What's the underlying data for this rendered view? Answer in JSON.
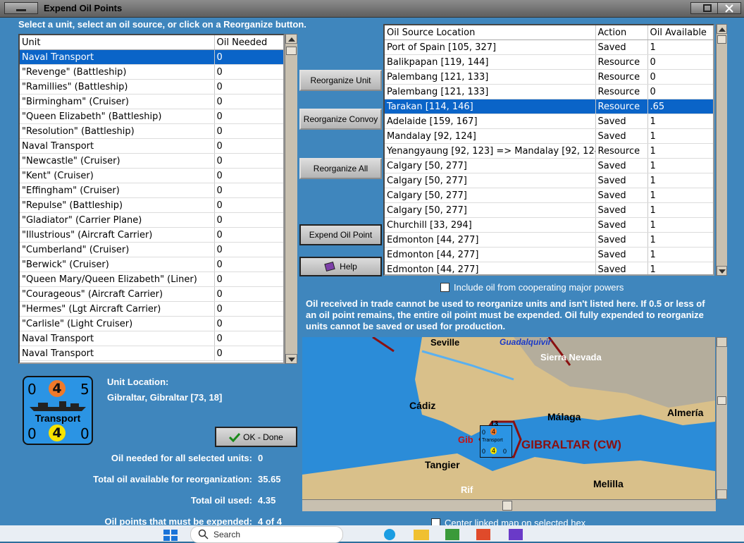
{
  "window": {
    "title": "Expend Oil Points"
  },
  "instruction": "Select a unit, select an oil source, or click on a Reorganize button.",
  "units_table": {
    "headers": [
      "Unit",
      "Oil Needed"
    ],
    "rows": [
      [
        "Naval Transport",
        "0"
      ],
      [
        "\"Revenge\" (Battleship)",
        "0"
      ],
      [
        "\"Ramillies\" (Battleship)",
        "0"
      ],
      [
        "\"Birmingham\" (Cruiser)",
        "0"
      ],
      [
        "\"Queen Elizabeth\" (Battleship)",
        "0"
      ],
      [
        "\"Resolution\" (Battleship)",
        "0"
      ],
      [
        "Naval Transport",
        "0"
      ],
      [
        "\"Newcastle\" (Cruiser)",
        "0"
      ],
      [
        "\"Kent\" (Cruiser)",
        "0"
      ],
      [
        "\"Effingham\" (Cruiser)",
        "0"
      ],
      [
        "\"Repulse\" (Battleship)",
        "0"
      ],
      [
        "\"Gladiator\" (Carrier Plane)",
        "0"
      ],
      [
        "\"Illustrious\" (Aircraft Carrier)",
        "0"
      ],
      [
        "\"Cumberland\" (Cruiser)",
        "0"
      ],
      [
        "\"Berwick\" (Cruiser)",
        "0"
      ],
      [
        "\"Queen Mary/Queen Elizabeth\" (Liner)",
        "0"
      ],
      [
        "\"Courageous\" (Aircraft Carrier)",
        "0"
      ],
      [
        "\"Hermes\" (Lgt Aircraft Carrier)",
        "0"
      ],
      [
        "\"Carlisle\" (Light Cruiser)",
        "0"
      ],
      [
        "Naval Transport",
        "0"
      ],
      [
        "Naval Transport",
        "0"
      ]
    ],
    "selected_index": 0
  },
  "buttons": {
    "reorganize_unit": "Reorganize Unit",
    "reorganize_convoy": "Reorganize Convoy",
    "reorganize_all": "Reorganize All",
    "expend_oil_point": "Expend Oil Point",
    "help": "Help",
    "ok_done": "OK - Done"
  },
  "oil_table": {
    "headers": [
      "Oil Source Location",
      "Action",
      "Oil Available"
    ],
    "rows": [
      [
        "Port of Spain [105, 327]",
        "Saved",
        "1"
      ],
      [
        "Balikpapan [119, 144]",
        "Resource",
        "0"
      ],
      [
        "Palembang [121, 133]",
        "Resource",
        "0"
      ],
      [
        "Palembang [121, 133]",
        "Resource",
        "0"
      ],
      [
        "Tarakan [114, 146]",
        "Resource",
        ".65"
      ],
      [
        "Adelaide [159, 167]",
        "Saved",
        "1"
      ],
      [
        "Mandalay [92, 124]",
        "Saved",
        "1"
      ],
      [
        "Yenangyaung [92, 123] => Mandalay [92, 124]",
        "Resource",
        "1"
      ],
      [
        "Calgary [50, 277]",
        "Saved",
        "1"
      ],
      [
        "Calgary [50, 277]",
        "Saved",
        "1"
      ],
      [
        "Calgary [50, 277]",
        "Saved",
        "1"
      ],
      [
        "Calgary [50, 277]",
        "Saved",
        "1"
      ],
      [
        "Churchill [33, 294]",
        "Saved",
        "1"
      ],
      [
        "Edmonton [44, 277]",
        "Saved",
        "1"
      ],
      [
        "Edmonton [44, 277]",
        "Saved",
        "1"
      ],
      [
        "Edmonton [44, 277]",
        "Saved",
        "1"
      ]
    ],
    "selected_index": 4
  },
  "include_coop_label": "Include oil from cooperating major powers",
  "note": "Oil received in trade cannot be used to reorganize units and isn't listed here.  If 0.5 or less of an oil point remains, the entire oil point must be expended.   Oil fully expended to reorganize units cannot be saved or used for production.",
  "counter": {
    "tl": "0",
    "tc": "4",
    "tr": "5",
    "name": "Transport",
    "bl": "0",
    "bc": "4",
    "br": "0"
  },
  "unit_location": {
    "label": "Unit Location:",
    "value": "Gibraltar, Gibraltar [73, 18]"
  },
  "stats": [
    {
      "label": "Oil needed for all selected units:",
      "value": "0"
    },
    {
      "label": "Total oil available for reorganization:",
      "value": "35.65"
    },
    {
      "label": "Total oil used:",
      "value": "4.35"
    },
    {
      "label": "Oil points that must be expended:",
      "value": "4 of 4"
    }
  ],
  "center_map_label": "Center linked map on selected hex",
  "map": {
    "labels": [
      "Seville",
      "Guadalquivir",
      "Sierra Nevada",
      "Cádiz",
      "Málaga",
      "Almería",
      "GIBRALTAR (CW)",
      "Gib",
      "Tangier",
      "Melilla",
      "Rif"
    ],
    "stack": {
      "top": "13",
      "tl": "0",
      "tc": "4",
      "name": "Transport",
      "bl": "0",
      "bc": "4",
      "br": "0"
    }
  },
  "taskbar": {
    "search_placeholder": "Search"
  },
  "colors": {
    "background": "#3f86bd",
    "selection": "#0a64c8",
    "map_sea": "#2b8cd8",
    "accent_red": "#8a1010"
  }
}
